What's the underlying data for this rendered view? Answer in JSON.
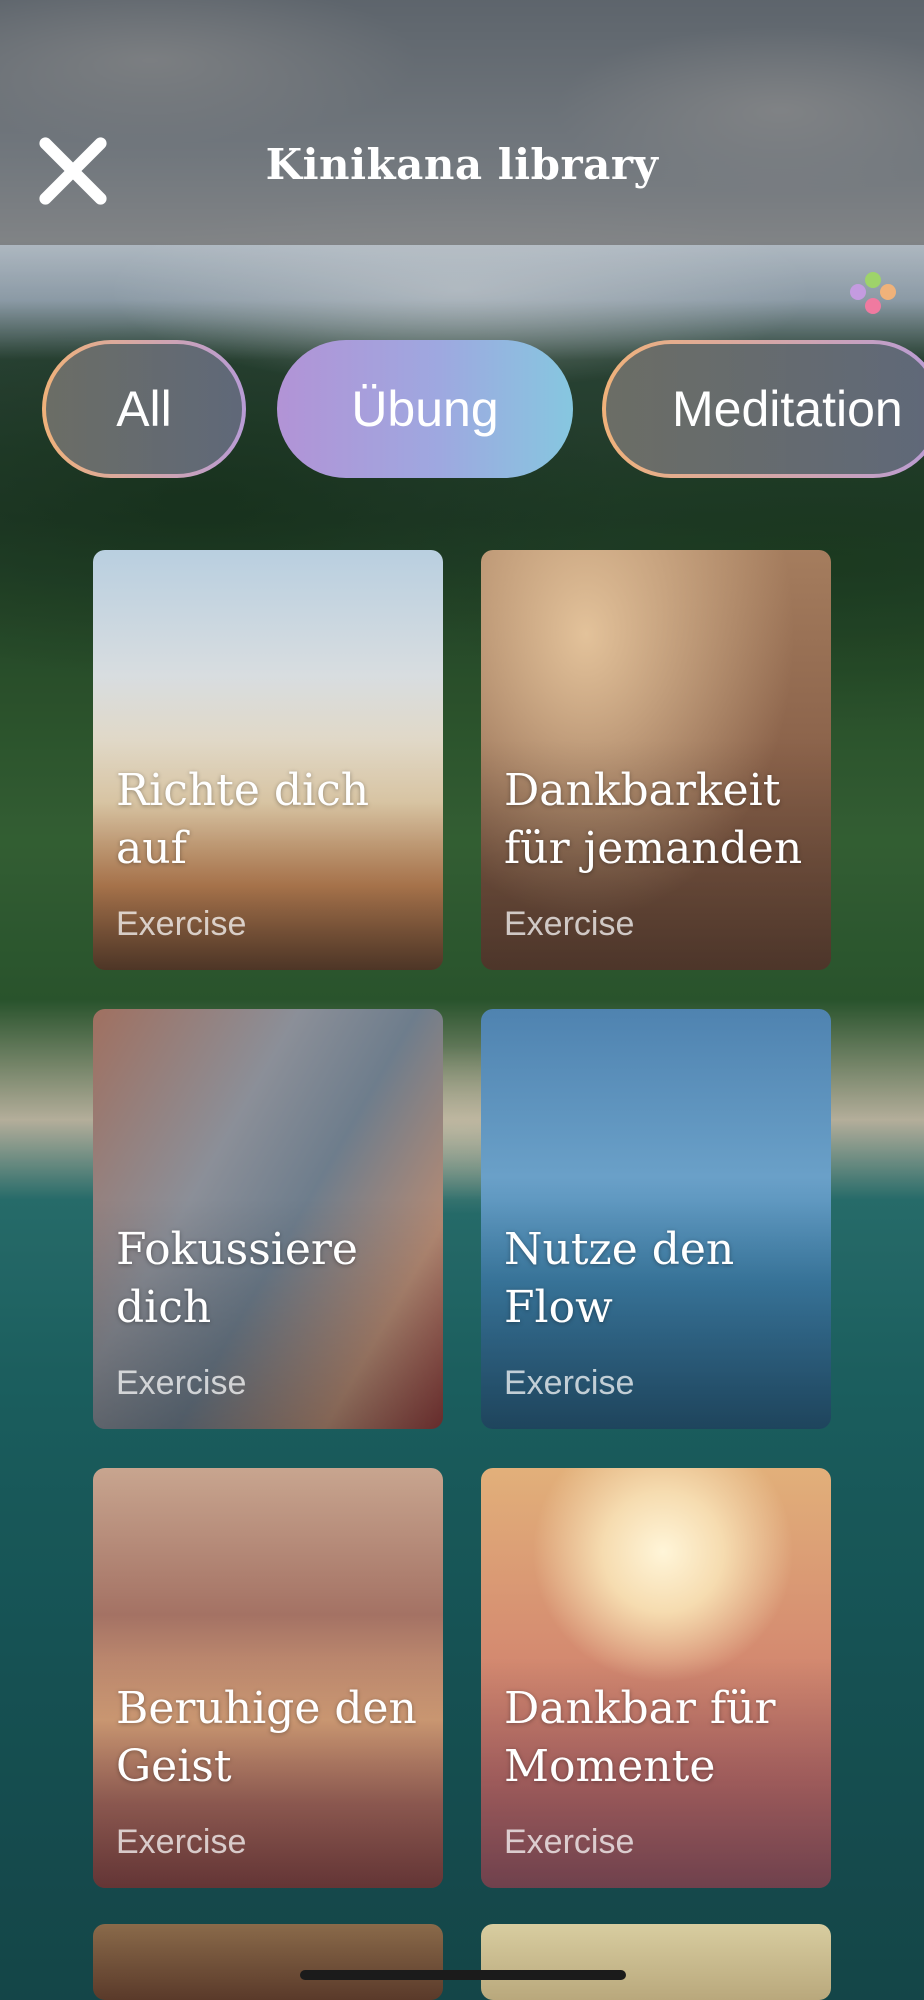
{
  "header": {
    "title": "Kinikana library",
    "close_icon": "close-icon"
  },
  "filters": [
    {
      "label": "All",
      "active": false
    },
    {
      "label": "Übung",
      "active": true
    },
    {
      "label": "Meditation",
      "active": false
    }
  ],
  "cards": [
    {
      "title": "Richte dich auf",
      "subtitle": "Exercise"
    },
    {
      "title": "Dankbarkeit für jemanden",
      "subtitle": "Exercise"
    },
    {
      "title": "Fokussiere dich",
      "subtitle": "Exercise"
    },
    {
      "title": "Nutze den Flow",
      "subtitle": "Exercise"
    },
    {
      "title": "Beruhige den Geist",
      "subtitle": "Exercise"
    },
    {
      "title": "Dankbar für Momente",
      "subtitle": "Exercise"
    }
  ],
  "colors": {
    "active_pill_gradient": [
      "#b293d6",
      "#86c7e0"
    ],
    "outline_gradient": [
      "#f0b27a",
      "#b89bd6"
    ],
    "dots": [
      "#9ed36a",
      "#c49be0",
      "#f0b27a",
      "#f07aa0",
      "#7ac8f0"
    ]
  }
}
